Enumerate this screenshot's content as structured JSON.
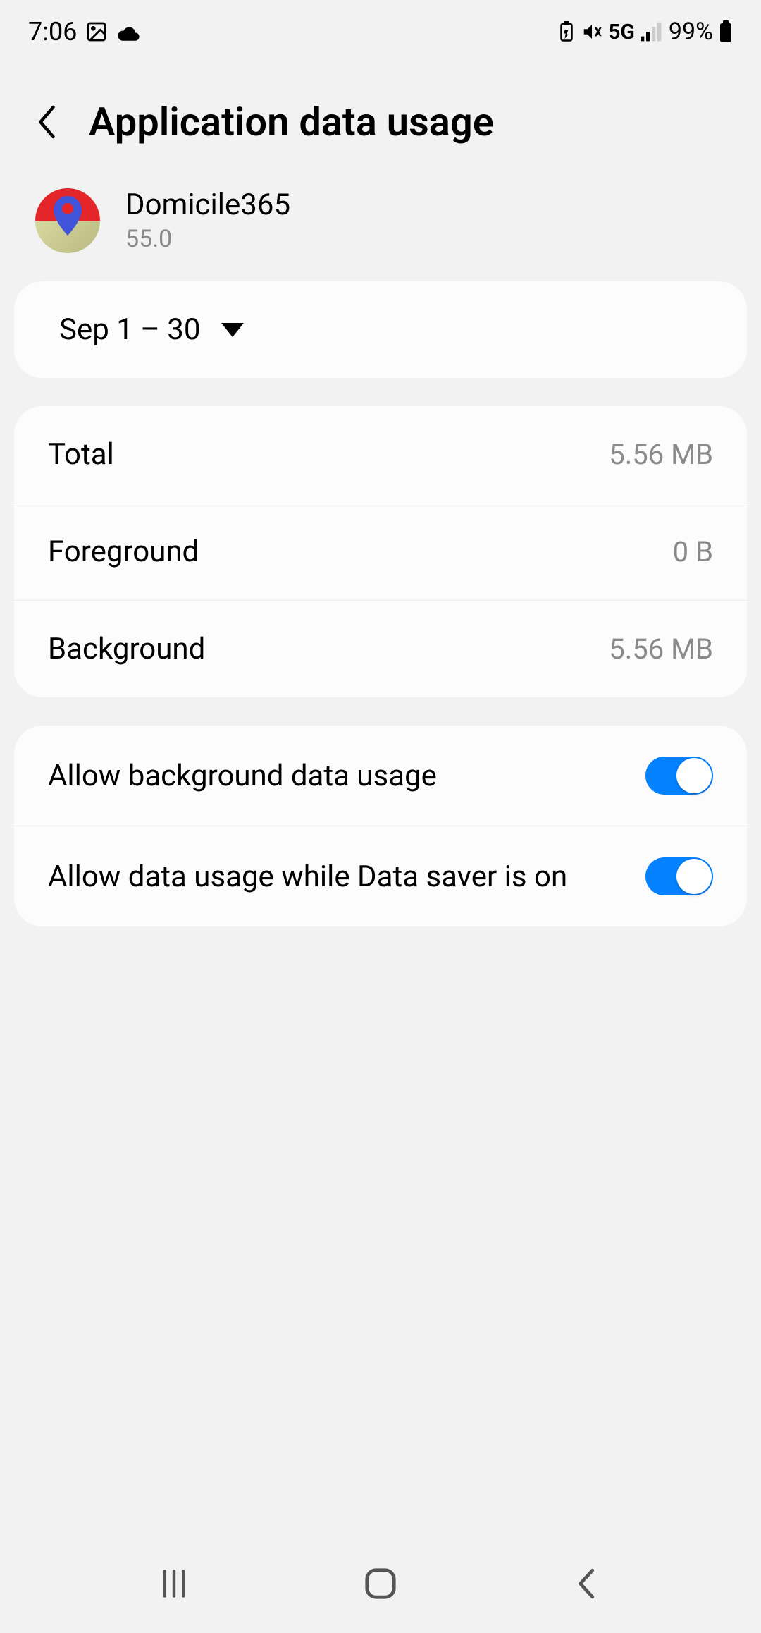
{
  "status": {
    "time": "7:06",
    "network": "5G",
    "battery": "99%"
  },
  "header": {
    "title": "Application data usage"
  },
  "app": {
    "name": "Domicile365",
    "version": "55.0"
  },
  "date_range": {
    "label": "Sep 1 – 30"
  },
  "usage": {
    "total_label": "Total",
    "total_value": "5.56 MB",
    "foreground_label": "Foreground",
    "foreground_value": "0 B",
    "background_label": "Background",
    "background_value": "5.56 MB"
  },
  "settings": {
    "allow_background_label": "Allow background data usage",
    "allow_datasaver_label": "Allow data usage while Data saver is on"
  }
}
